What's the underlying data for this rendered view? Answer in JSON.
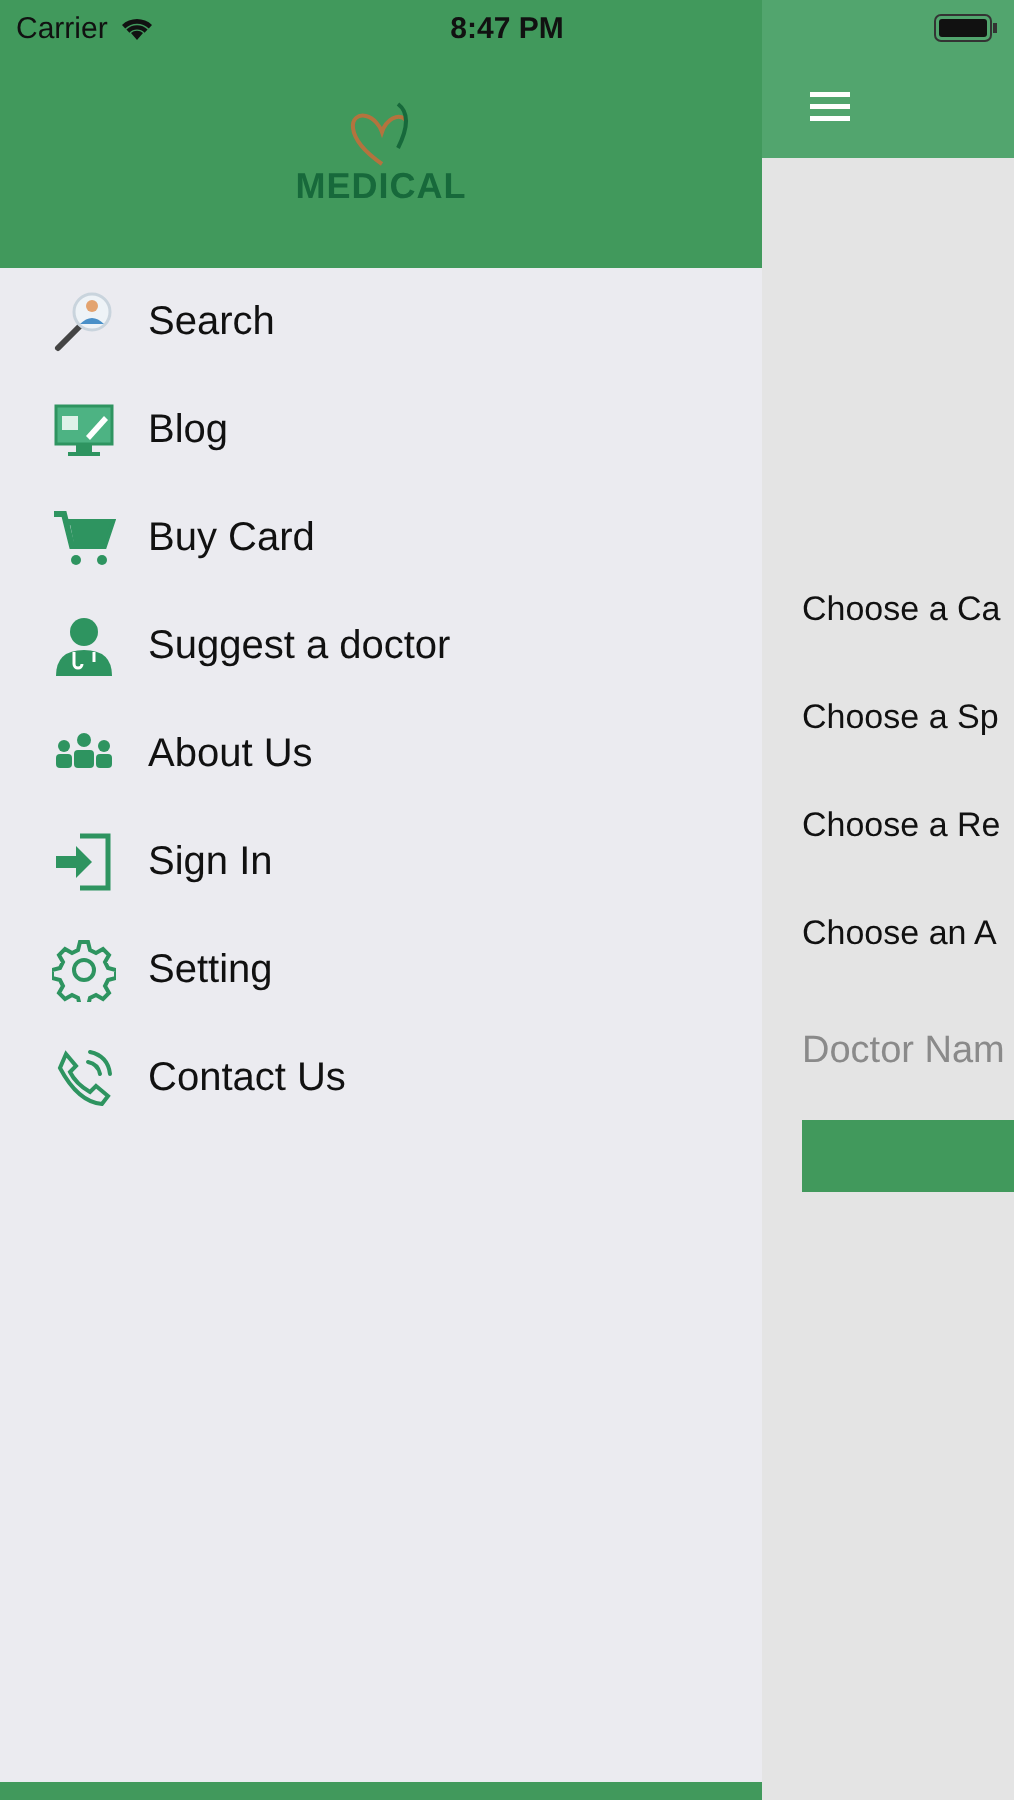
{
  "status_bar": {
    "carrier": "Carrier",
    "time": "8:47 PM"
  },
  "drawer": {
    "logo_text": "MEDICAL",
    "items": [
      {
        "label": "Search",
        "kind": "search"
      },
      {
        "label": "Blog",
        "kind": "blog"
      },
      {
        "label": "Buy Card",
        "kind": "cart"
      },
      {
        "label": "Suggest a doctor",
        "kind": "doctor"
      },
      {
        "label": "About Us",
        "kind": "people"
      },
      {
        "label": "Sign In",
        "kind": "signin"
      },
      {
        "label": "Setting",
        "kind": "gear"
      },
      {
        "label": "Contact Us",
        "kind": "phone"
      }
    ]
  },
  "main": {
    "selectors": [
      "Choose a Ca",
      "Choose a Sp",
      "Choose a Re",
      "Choose an A"
    ],
    "name_field": {
      "placeholder": "Doctor Nam"
    }
  }
}
